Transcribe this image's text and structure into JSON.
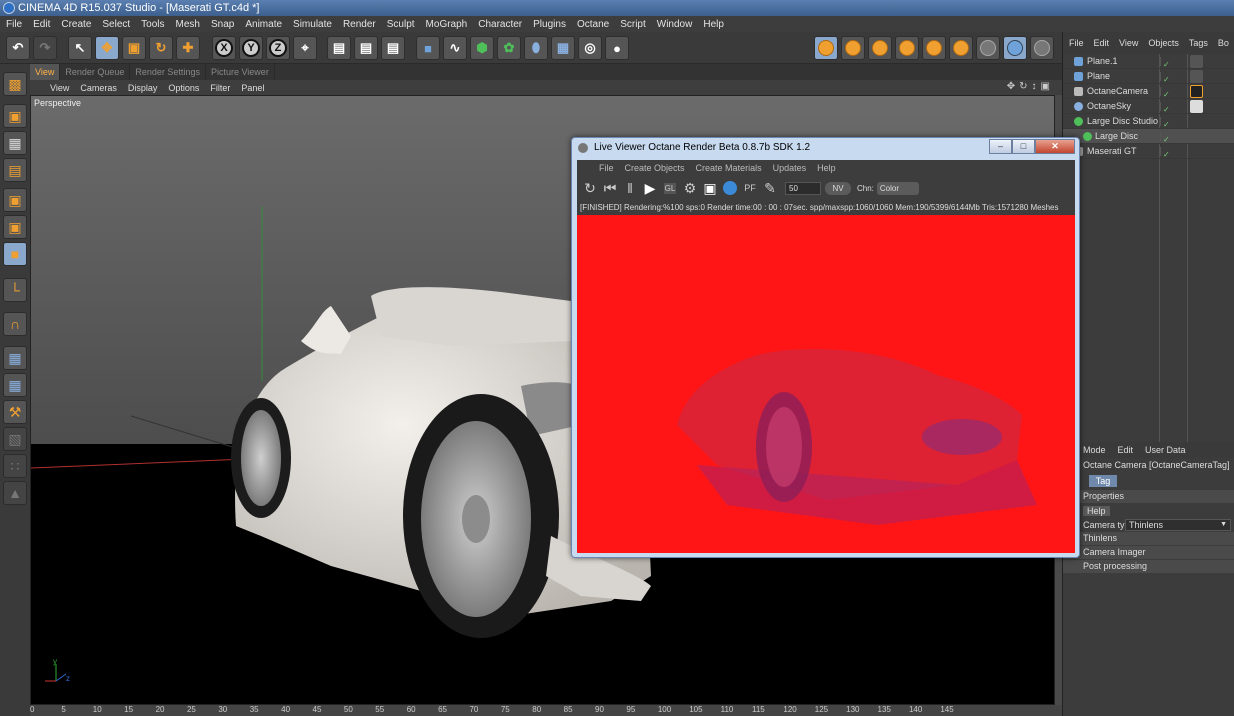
{
  "window": {
    "title": "CINEMA 4D R15.037 Studio - [Maserati GT.c4d *]"
  },
  "menu": [
    "File",
    "Edit",
    "Create",
    "Select",
    "Tools",
    "Mesh",
    "Snap",
    "Animate",
    "Simulate",
    "Render",
    "Sculpt",
    "MoGraph",
    "Character",
    "Plugins",
    "Octane",
    "Script",
    "Window",
    "Help"
  ],
  "toolbar": {
    "axis_labels": [
      "X",
      "Y",
      "Z"
    ]
  },
  "view_tabs": [
    "View",
    "Render Queue",
    "Render Settings",
    "Picture Viewer"
  ],
  "viewport": {
    "menu": [
      "View",
      "Cameras",
      "Display",
      "Options",
      "Filter",
      "Panel"
    ],
    "label": "Perspective",
    "axis_y": "y",
    "axis_z": "z"
  },
  "timeline": {
    "ticks": [
      "0",
      "5",
      "10",
      "15",
      "20",
      "25",
      "30",
      "35",
      "40",
      "45",
      "50",
      "55",
      "60",
      "65",
      "70",
      "75",
      "80",
      "85",
      "90",
      "95",
      "100",
      "105",
      "110",
      "115",
      "120",
      "125",
      "130",
      "135",
      "140",
      "145"
    ]
  },
  "object_manager": {
    "menu": [
      "File",
      "Edit",
      "View",
      "Objects",
      "Tags",
      "Bo"
    ],
    "objects": [
      {
        "name": "Plane.1",
        "icon": "plane-icon"
      },
      {
        "name": "Plane",
        "icon": "plane-icon"
      },
      {
        "name": "OctaneCamera",
        "icon": "camera-icon"
      },
      {
        "name": "OctaneSky",
        "icon": "sky-icon"
      },
      {
        "name": "Large Disc Studio",
        "icon": "null-icon"
      },
      {
        "name": "Large Disc",
        "icon": "null-icon"
      },
      {
        "name": "Maserati GT",
        "icon": "object-icon"
      }
    ]
  },
  "attribute_manager": {
    "menu": [
      "Mode",
      "Edit",
      "User Data"
    ],
    "title": "Octane Camera [OctaneCameraTag]",
    "tag_tab": "Tag",
    "section_properties": "Properties",
    "help": "Help",
    "camera_type_label": "Camera type",
    "camera_type_value": "Thinlens",
    "sections": [
      "Thinlens",
      "Camera Imager",
      "Post processing"
    ]
  },
  "live_viewer": {
    "title": "Live Viewer    Octane Render Beta 0.8.7b   SDK 1.2",
    "menu": [
      "File",
      "Create Objects",
      "Create Materials",
      "Updates",
      "Help"
    ],
    "spp_value": "50",
    "nv_label": "NV",
    "channel_label": "Chn:",
    "channel_value": "Color",
    "status": "[FINISHED]  Rendering:%100 sps:0 Render time:00 : 00 : 07sec. spp/maxspp:1060/1060 Mem:190/5399/6144Mb Tris:1571280 Meshes",
    "render_color": "#ff1515"
  }
}
